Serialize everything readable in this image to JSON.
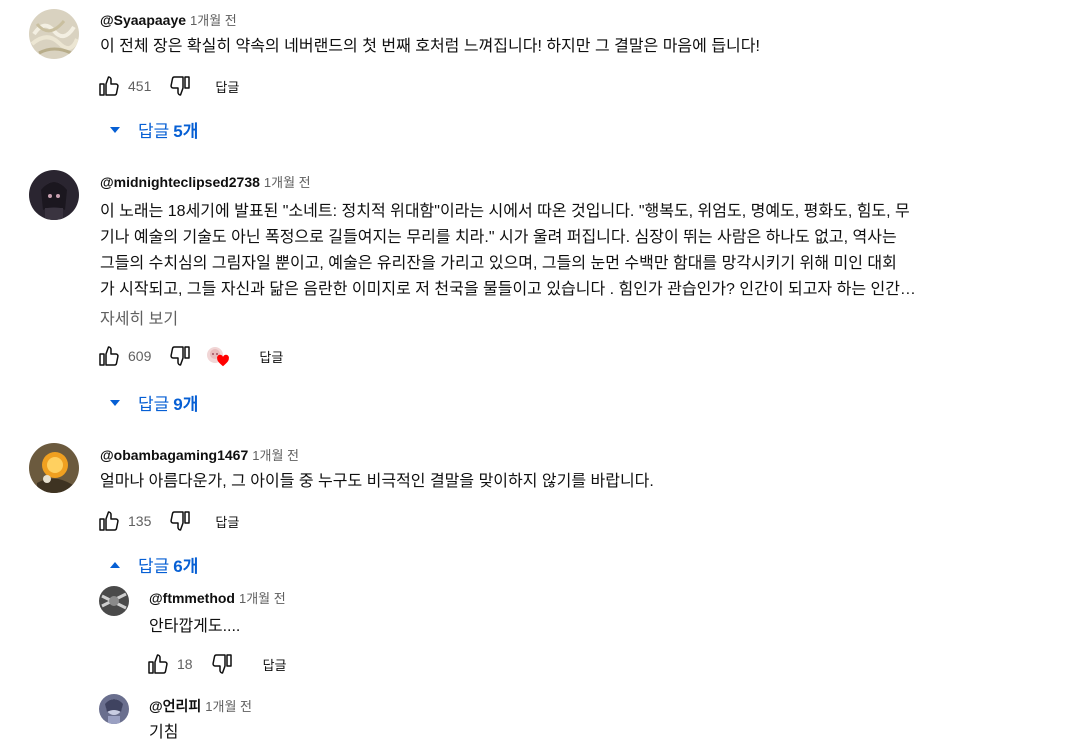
{
  "comments": [
    {
      "author": "@Syaapaaye",
      "time": "1개월 전",
      "text_lines": [
        "이 전체 장은 확실히 약속의 네버랜드의 첫 번째 호처럼 느껴집니다! 하지만 그 결말은 마음에 듭니다!"
      ],
      "likes": "451",
      "reply_label": "답글",
      "replies_toggle": {
        "prefix": "답글",
        "count": "5개",
        "state": "collapsed"
      }
    },
    {
      "author": "@midnighteclipsed2738",
      "time": "1개월 전",
      "text_lines": [
        "이 노래는 18세기에 발표된 \"소네트: 정치적 위대함\"이라는 시에서 따온 것입니다. \"행복도, 위엄도, 명예도, 평화도, 힘도, 무",
        "기나 예술의 기술도 아닌 폭정으로 길들여지는 무리를 치라.\" 시가 울려 퍼집니다. 심장이 뛰는 사람은 하나도 없고, 역사는",
        "그들의 수치심의 그림자일 뿐이고, 예술은 유리잔을 가리고 있으며, 그들의 눈먼 수백만 함대를 망각시키기 위해 미인 대회",
        "가 시작되고, 그들 자신과 닮은 음란한 이미지로 저 천국을 물들이고 있습니다 . 힘인가 관습인가? 인간이 되고자 하는 인간…"
      ],
      "more_label": "자세히 보기",
      "likes": "609",
      "reply_label": "답글",
      "replies_toggle": {
        "prefix": "답글",
        "count": "9개",
        "state": "collapsed"
      }
    },
    {
      "author": "@obambagaming1467",
      "time": "1개월 전",
      "text_lines": [
        "얼마나 아름다운가, 그 아이들 중 누구도 비극적인 결말을 맞이하지 않기를 바랍니다."
      ],
      "likes": "135",
      "reply_label": "답글",
      "replies_toggle": {
        "prefix": "답글",
        "count": "6개",
        "state": "expanded"
      }
    }
  ],
  "replies": [
    {
      "author": "@ftmmethod",
      "time": "1개월 전",
      "text": "안타깝게도....",
      "likes": "18",
      "reply_label": "답글"
    },
    {
      "author": "@언리피",
      "time": "1개월 전",
      "text": "기침"
    }
  ],
  "colors": {
    "link_blue": "#065fd4",
    "secondary_text": "#606060",
    "heart_red": "#ff0000"
  }
}
